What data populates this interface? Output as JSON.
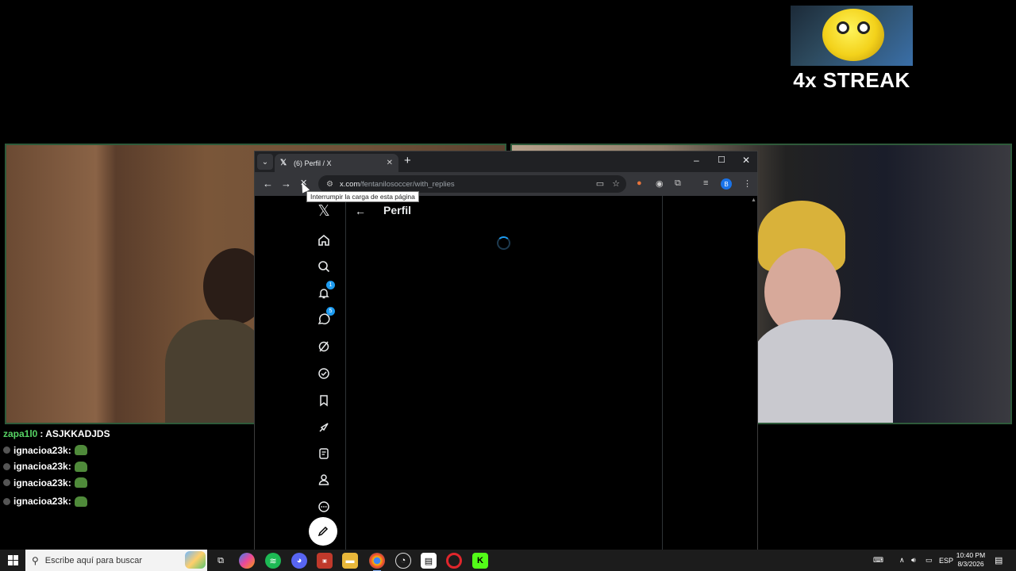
{
  "overlay": {
    "streak_text": "4x STREAK"
  },
  "chat": {
    "messages": [
      {
        "user": "zapa1l0",
        "text": ": ASJKKADJDS"
      },
      {
        "user": "ignacioa23k",
        "text": " :"
      },
      {
        "user": "ignacioa23k",
        "text": " :"
      },
      {
        "user": "ignacioa23k",
        "text": " :"
      },
      {
        "user": "ignacioa23k",
        "text": " :"
      }
    ]
  },
  "browser": {
    "tab_title": "(6) Perfil / X",
    "url_domain": "x.com",
    "url_path": "/fentanilosoccer/with_replies",
    "tooltip": "Interrumpir la carga de esta página",
    "profile_initial": "B"
  },
  "x": {
    "page_title": "Perfil",
    "notifications_badge": "1",
    "messages_badge": "5"
  },
  "taskbar": {
    "search_placeholder": "Escribe aquí para buscar",
    "language": "ESP",
    "time": "10:40 PM",
    "date": "8/3/2026"
  },
  "colors": {
    "x_blue": "#1d9bf0",
    "chat_highlight": "#56d364",
    "cam_border": "#2e5a3a"
  },
  "icons": [
    "x-logo-icon",
    "home-icon",
    "search-icon",
    "bell-icon",
    "messages-icon",
    "grok-icon",
    "verified-icon",
    "bookmark-icon",
    "rocket-icon",
    "lists-icon",
    "profile-icon",
    "more-icon",
    "compose-icon"
  ]
}
